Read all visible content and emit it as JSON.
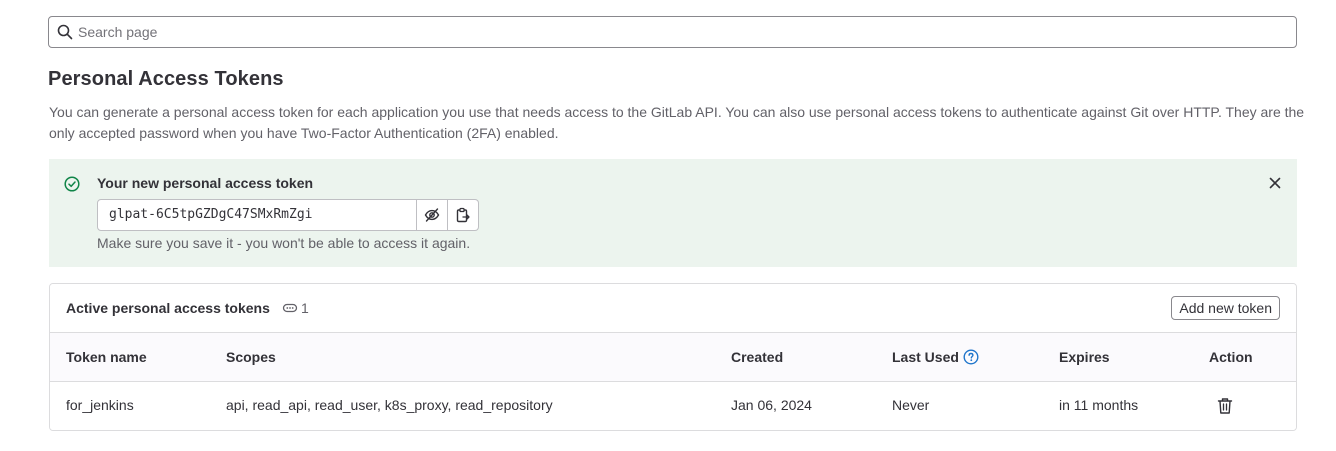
{
  "search": {
    "placeholder": "Search page"
  },
  "page": {
    "title": "Personal Access Tokens",
    "description": "You can generate a personal access token for each application you use that needs access to the GitLab API. You can also use personal access tokens to authenticate against Git over HTTP. They are the only accepted password when you have Two-Factor Authentication (2FA) enabled."
  },
  "alert": {
    "title": "Your new personal access token",
    "token_value": "glpat-6C5tpGZDgC47SMxRmZgi",
    "note": "Make sure you save it - you won't be able to access it again.",
    "icons": [
      "check-circle-icon",
      "close-icon",
      "eye-slash-icon",
      "copy-to-clipboard-icon"
    ]
  },
  "tokens": {
    "title": "Active personal access tokens",
    "count": "1",
    "add_button": "Add new token",
    "columns": [
      "Token name",
      "Scopes",
      "Created",
      "Last Used",
      "Expires",
      "Action"
    ],
    "rows": [
      {
        "name": "for_jenkins",
        "scopes": "api, read_api, read_user, k8s_proxy, read_repository",
        "created": "Jan 06, 2024",
        "last_used": "Never",
        "expires": "in 11 months",
        "action_icon": "trash-icon"
      }
    ]
  },
  "colors": {
    "success_bg": "#ecf4ee",
    "success_icon": "#108548",
    "help_icon": "#1f75cb",
    "border": "#dcdcde"
  }
}
